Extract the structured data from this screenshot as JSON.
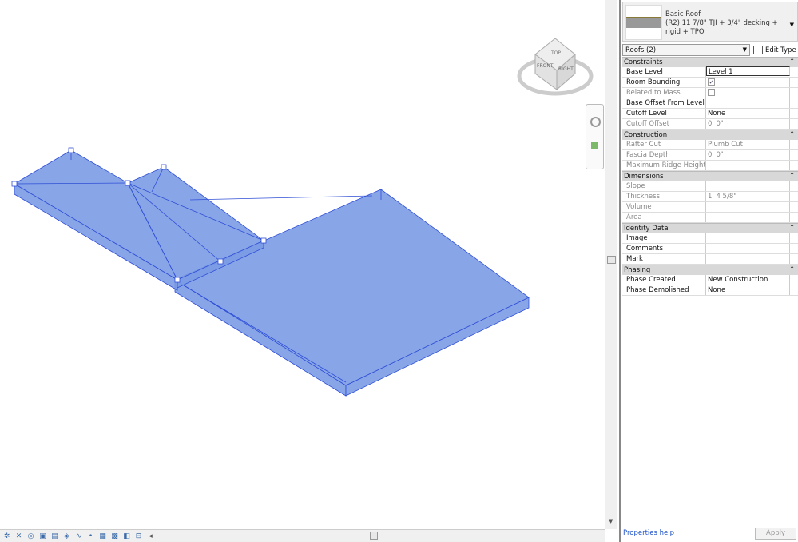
{
  "type_selector": {
    "family": "Basic Roof",
    "type": "(R2) 11 7/8\" TJI + 3/4\" decking + rigid + TPO"
  },
  "filter": {
    "value": "Roofs (2)",
    "edit_type": "Edit Type"
  },
  "viewcube": {
    "top": "TOP",
    "front": "FRONT",
    "right": "RIGHT"
  },
  "groups": [
    {
      "name": "Constraints",
      "rows": [
        {
          "label": "Base Level",
          "value": "Level 1",
          "editable": true
        },
        {
          "label": "Room Bounding",
          "value": "",
          "checkbox": true,
          "checked": true
        },
        {
          "label": "Related to Mass",
          "value": "",
          "checkbox": true,
          "checked": false,
          "disabled": true
        },
        {
          "label": "Base Offset From Level",
          "value": ""
        },
        {
          "label": "Cutoff Level",
          "value": "None"
        },
        {
          "label": "Cutoff Offset",
          "value": "0'  0\"",
          "disabled": true
        }
      ]
    },
    {
      "name": "Construction",
      "rows": [
        {
          "label": "Rafter Cut",
          "value": "Plumb Cut",
          "disabled": true
        },
        {
          "label": "Fascia Depth",
          "value": "0'  0\"",
          "disabled": true
        },
        {
          "label": "Maximum Ridge Height",
          "value": "",
          "disabled": true
        }
      ]
    },
    {
      "name": "Dimensions",
      "rows": [
        {
          "label": "Slope",
          "value": "",
          "disabled": true
        },
        {
          "label": "Thickness",
          "value": "1'  4 5/8\"",
          "disabled": true
        },
        {
          "label": "Volume",
          "value": "",
          "disabled": true
        },
        {
          "label": "Area",
          "value": "",
          "disabled": true
        }
      ]
    },
    {
      "name": "Identity Data",
      "rows": [
        {
          "label": "Image",
          "value": ""
        },
        {
          "label": "Comments",
          "value": ""
        },
        {
          "label": "Mark",
          "value": ""
        }
      ]
    },
    {
      "name": "Phasing",
      "rows": [
        {
          "label": "Phase Created",
          "value": "New Construction"
        },
        {
          "label": "Phase Demolished",
          "value": "None"
        }
      ]
    }
  ],
  "footer": {
    "help": "Properties help",
    "apply": "Apply"
  },
  "colors": {
    "roof_fill": "#7b9be6",
    "roof_edge": "#2f4fd6"
  },
  "status_icons": [
    "worksharing-icon",
    "remove-icon",
    "reveal-icon",
    "temporary-hide-icon",
    "crop-icon",
    "show-crop-icon",
    "render-icon",
    "sun-path-icon",
    "visual-style-icon",
    "detail-level-icon",
    "scale-icon",
    "highlight-icon"
  ]
}
